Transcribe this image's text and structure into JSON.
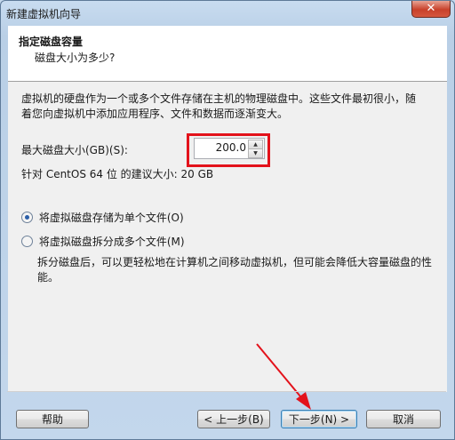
{
  "window": {
    "title": "新建虚拟机向导",
    "close_label": "✕"
  },
  "header": {
    "title": "指定磁盘容量",
    "subtitle": "磁盘大小为多少?"
  },
  "main": {
    "description": "虚拟机的硬盘作为一个或多个文件存储在主机的物理磁盘中。这些文件最初很小，随着您向虚拟机中添加应用程序、文件和数据而逐渐变大。",
    "max_size_label": "最大磁盘大小(GB)(S):",
    "max_size_value": "200.0",
    "recommendation": "针对 CentOS 64 位 的建议大小: 20 GB",
    "options": [
      {
        "label": "将虚拟磁盘存储为单个文件(O)",
        "checked": true
      },
      {
        "label": "将虚拟磁盘拆分成多个文件(M)",
        "checked": false
      }
    ],
    "split_description": "拆分磁盘后，可以更轻松地在计算机之间移动虚拟机，但可能会降低大容量磁盘的性能。"
  },
  "buttons": {
    "help": "帮助",
    "back": "< 上一步(B)",
    "next": "下一步(N) >",
    "cancel": "取消"
  },
  "annotation_color": "#e3121b"
}
